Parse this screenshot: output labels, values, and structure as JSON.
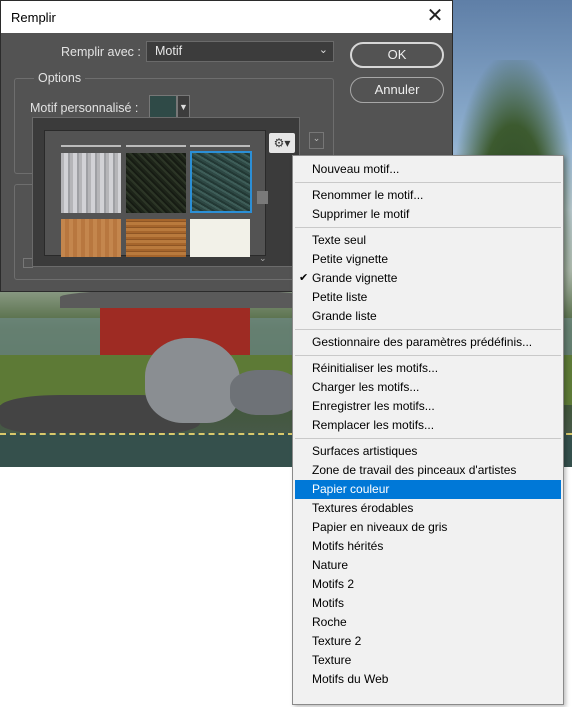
{
  "dialog": {
    "title": "Remplir",
    "close_glyph": "✕",
    "fill_with_label": "Remplir avec :",
    "fill_with_value": "Motif",
    "ok_label": "OK",
    "cancel_label": "Annuler",
    "options_legend": "Options",
    "custom_pattern_label": "Motif personnalisé :"
  },
  "picker": {
    "gear_icon": "gear-icon",
    "selected_index": 2,
    "thumbnails": [
      "thumb-1",
      "thumb-2",
      "thumb-3",
      "thumb-4",
      "thumb-5",
      "thumb-6"
    ]
  },
  "menu": {
    "selected_color": "#0078d7",
    "items": [
      {
        "label": "Nouveau motif..."
      },
      {
        "separator": true
      },
      {
        "label": "Renommer le motif..."
      },
      {
        "label": "Supprimer le motif"
      },
      {
        "separator": true
      },
      {
        "label": "Texte seul"
      },
      {
        "label": "Petite vignette"
      },
      {
        "label": "Grande vignette",
        "checked": true
      },
      {
        "label": "Petite liste"
      },
      {
        "label": "Grande liste"
      },
      {
        "separator": true
      },
      {
        "label": "Gestionnaire des paramètres prédéfinis..."
      },
      {
        "separator": true
      },
      {
        "label": "Réinitialiser les motifs..."
      },
      {
        "label": "Charger les motifs..."
      },
      {
        "label": "Enregistrer les motifs..."
      },
      {
        "label": "Remplacer les motifs..."
      },
      {
        "separator": true
      },
      {
        "label": "Surfaces artistiques"
      },
      {
        "label": "Zone de travail des pinceaux d'artistes"
      },
      {
        "label": "Papier couleur",
        "highlighted": true
      },
      {
        "label": "Textures érodables"
      },
      {
        "label": "Papier en niveaux de gris"
      },
      {
        "label": "Motifs hérités"
      },
      {
        "label": "Nature"
      },
      {
        "label": "Motifs 2"
      },
      {
        "label": "Motifs"
      },
      {
        "label": "Roche"
      },
      {
        "label": "Texture 2"
      },
      {
        "label": "Texture"
      },
      {
        "label": "Motifs du Web"
      }
    ]
  }
}
